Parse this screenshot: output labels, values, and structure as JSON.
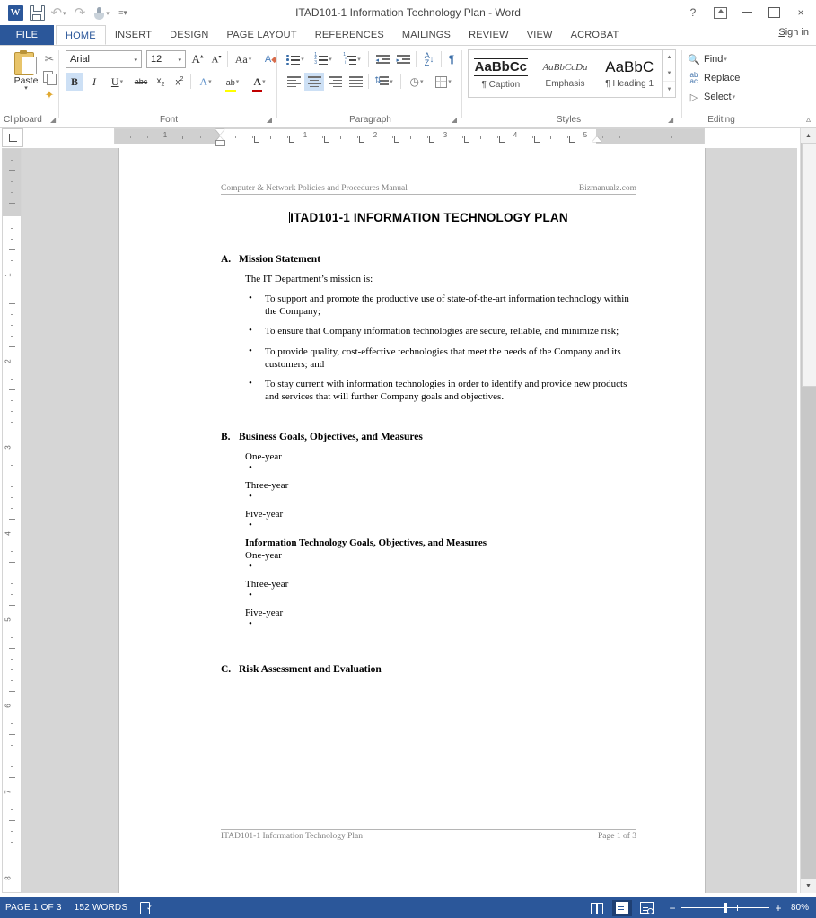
{
  "window": {
    "title": "ITAD101-1 Information Technology Plan - Word",
    "signin": "Sign in"
  },
  "qat": {
    "items": [
      {
        "name": "word-app-icon",
        "label": "W"
      },
      {
        "name": "save-icon",
        "label": "Save"
      },
      {
        "name": "undo-icon",
        "label": "Undo"
      },
      {
        "name": "redo-icon",
        "label": "Redo"
      },
      {
        "name": "touch-mode-icon",
        "label": "Touch/Mouse Mode"
      },
      {
        "name": "customize-qat-icon",
        "label": "Customize Quick Access Toolbar"
      }
    ]
  },
  "window_controls": {
    "help": "?",
    "ribbon_display": "Ribbon Display Options",
    "minimize": "Minimize",
    "maximize": "Maximize",
    "close": "×"
  },
  "tabs": {
    "file": "FILE",
    "items": [
      "HOME",
      "INSERT",
      "DESIGN",
      "PAGE LAYOUT",
      "REFERENCES",
      "MAILINGS",
      "REVIEW",
      "VIEW",
      "ACROBAT"
    ],
    "active": "HOME"
  },
  "ribbon": {
    "groups": [
      {
        "name": "Clipboard",
        "label": "Clipboard"
      },
      {
        "name": "Font",
        "label": "Font"
      },
      {
        "name": "Paragraph",
        "label": "Paragraph"
      },
      {
        "name": "Styles",
        "label": "Styles"
      },
      {
        "name": "Editing",
        "label": "Editing"
      }
    ],
    "clipboard": {
      "paste": "Paste",
      "cut": "Cut",
      "copy": "Copy",
      "format_painter": "Format Painter"
    },
    "font": {
      "font_name": "Arial",
      "font_size": "12",
      "grow": "A",
      "shrink": "A",
      "change_case": "Aa",
      "bold": "B",
      "italic": "I",
      "underline": "U",
      "strikethrough": "abc",
      "subscript": "x",
      "superscript": "x",
      "text_effects": "A",
      "highlight": "ab",
      "font_color": "A"
    },
    "styles": {
      "gallery": [
        {
          "preview": "AaBbCc",
          "name": "¶ Caption"
        },
        {
          "preview": "AaBbCcDa",
          "name": "Emphasis"
        },
        {
          "preview": "AaBbC",
          "name": "¶ Heading 1"
        }
      ]
    },
    "editing": {
      "find": "Find",
      "replace": "Replace",
      "select": "Select"
    }
  },
  "ruler": {
    "h_numbers": [
      "1",
      "1",
      "2",
      "3",
      "4",
      "5"
    ],
    "v_numbers": [
      "1",
      "2",
      "3",
      "4",
      "5",
      "6",
      "7",
      "8"
    ]
  },
  "document": {
    "header_left": "Computer & Network Policies and Procedures Manual",
    "header_right": "Bizmanualz.com",
    "title": "ITAD101-1   INFORMATION TECHNOLOGY PLAN",
    "sections": [
      {
        "letter": "A.",
        "heading": "Mission Statement"
      },
      {
        "letter": "B.",
        "heading": "Business Goals, Objectives, and Measures"
      },
      {
        "letter": "C.",
        "heading": "Risk Assessment and Evaluation"
      }
    ],
    "mission_intro": "The IT Department’s mission is:",
    "mission_bullets": [
      "To support and promote the productive use of state-of-the-art information technology within the Company;",
      "To ensure that Company information technologies are secure, reliable, and minimize risk;",
      "To provide quality, cost-effective technologies that meet the needs of the Company and its customers; and",
      "To stay current with information technologies in order to identify and provide new products and services that will further Company goals and objectives."
    ],
    "business_years": [
      "One-year",
      "Three-year",
      "Five-year"
    ],
    "it_goals_subhead": "Information Technology Goals, Objectives, and Measures",
    "it_years": [
      "One-year",
      "Three-year",
      "Five-year"
    ],
    "footer_left": "ITAD101-1 Information Technology Plan",
    "footer_right": "Page 1 of 3"
  },
  "status": {
    "page": "PAGE 1 OF 3",
    "words": "152 WORDS",
    "proofing": "Proofing errors",
    "views": [
      {
        "name": "read-mode",
        "label": "Read Mode",
        "active": false
      },
      {
        "name": "print-layout",
        "label": "Print Layout",
        "active": true
      },
      {
        "name": "web-layout",
        "label": "Web Layout",
        "active": false
      }
    ],
    "zoom_out": "−",
    "zoom_in": "+",
    "zoom_value": "80%"
  },
  "colors": {
    "accent": "#2b579a",
    "ribbon_bg": "#ffffff",
    "page_bg": "#d6d6d6"
  }
}
